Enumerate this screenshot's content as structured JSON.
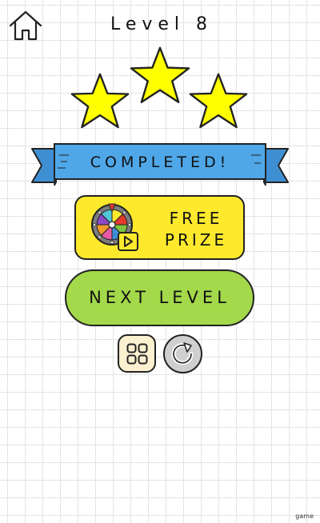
{
  "header": {
    "level_title": "Level 8",
    "home_icon": "home-icon"
  },
  "result": {
    "stars_earned": 3,
    "stars_total": 3,
    "star_color": "#ffff00",
    "banner_text": "COMPLETED!",
    "banner_color": "#4fa7e8"
  },
  "buttons": {
    "free_prize_line1": "FREE",
    "free_prize_line2": "PRIZE",
    "free_prize_color": "#ffe92d",
    "free_prize_icon": "prize-wheel-video-icon",
    "next_level": "NEXT LEVEL",
    "next_level_color": "#a3d94a",
    "levels_icon": "grid-icon",
    "restart_icon": "restart-icon"
  },
  "footer": {
    "watermark": "game"
  }
}
